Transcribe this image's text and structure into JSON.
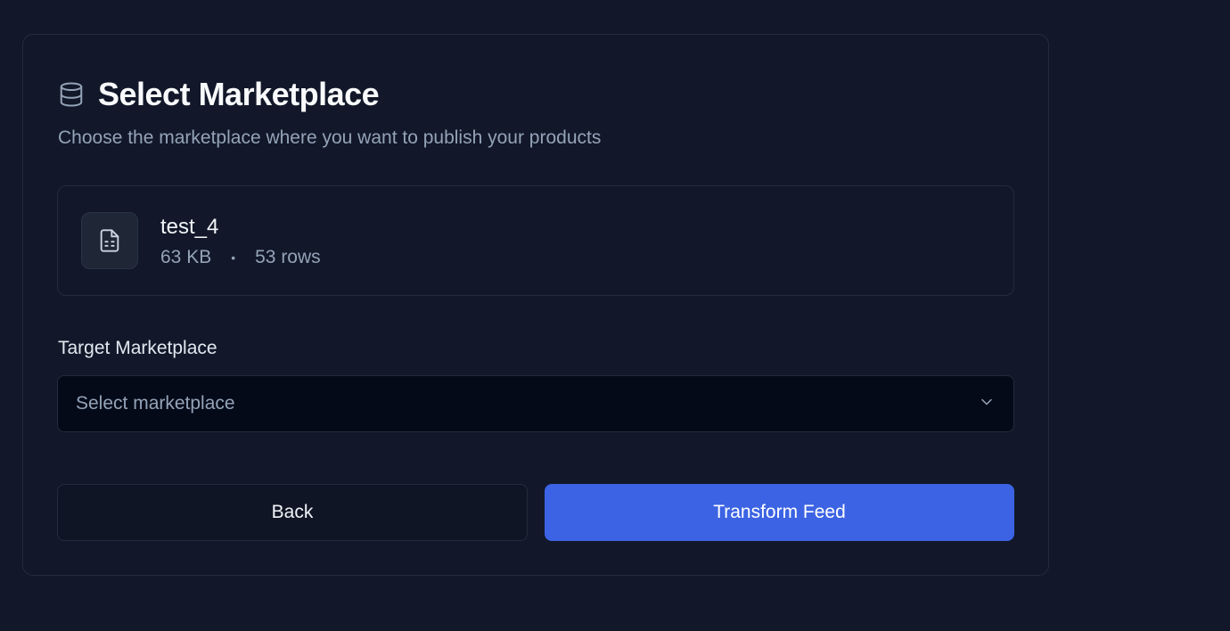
{
  "header": {
    "title": "Select Marketplace",
    "icon": "database-icon",
    "subtitle": "Choose the marketplace where you want to publish your products"
  },
  "file": {
    "icon": "file-spreadsheet-icon",
    "name": "test_4",
    "size": "63 KB",
    "separator": "•",
    "rows": "53 rows"
  },
  "marketplace": {
    "label": "Target Marketplace",
    "placeholder": "Select marketplace",
    "icon": "chevron-down-icon"
  },
  "actions": {
    "back_label": "Back",
    "transform_label": "Transform Feed"
  },
  "colors": {
    "background": "#121829",
    "primary": "#3b63e3",
    "border": "#232b3d",
    "muted_text": "#94a3b8"
  }
}
